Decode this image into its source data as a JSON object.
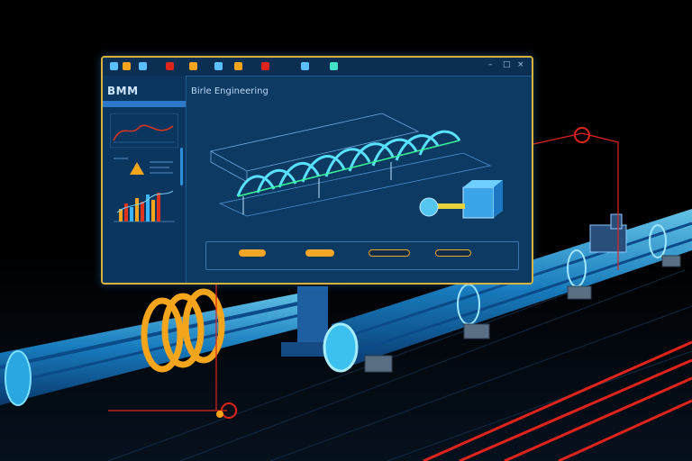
{
  "app": {
    "brand": "BMM",
    "main_title": "Birle Engineering",
    "toolbar": {
      "icons": [
        "file-icon",
        "edit-icon",
        "view-icon",
        "tools-icon",
        "model-icon",
        "grid-icon",
        "layer-icon",
        "measure-icon",
        "settings-icon",
        "render-icon"
      ],
      "window_controls": [
        "–",
        "□",
        "×"
      ]
    },
    "sidebar": {
      "sections": [
        "section-trend",
        "section-alerts",
        "section-analytics"
      ]
    },
    "panel": {
      "buttons": [
        {
          "name": "panel-button-1",
          "color": "#f3a623"
        },
        {
          "name": "panel-button-2",
          "color": "#f3a623"
        },
        {
          "name": "panel-button-3",
          "color": "#f3a623"
        },
        {
          "name": "panel-button-4",
          "color": "#f3a623"
        }
      ]
    }
  },
  "colors": {
    "accent": "#d9b23c",
    "frame": "#0d3a63",
    "pipe": "#1ea9e6",
    "warning": "#e0241c",
    "ring": "#f4a51b"
  }
}
